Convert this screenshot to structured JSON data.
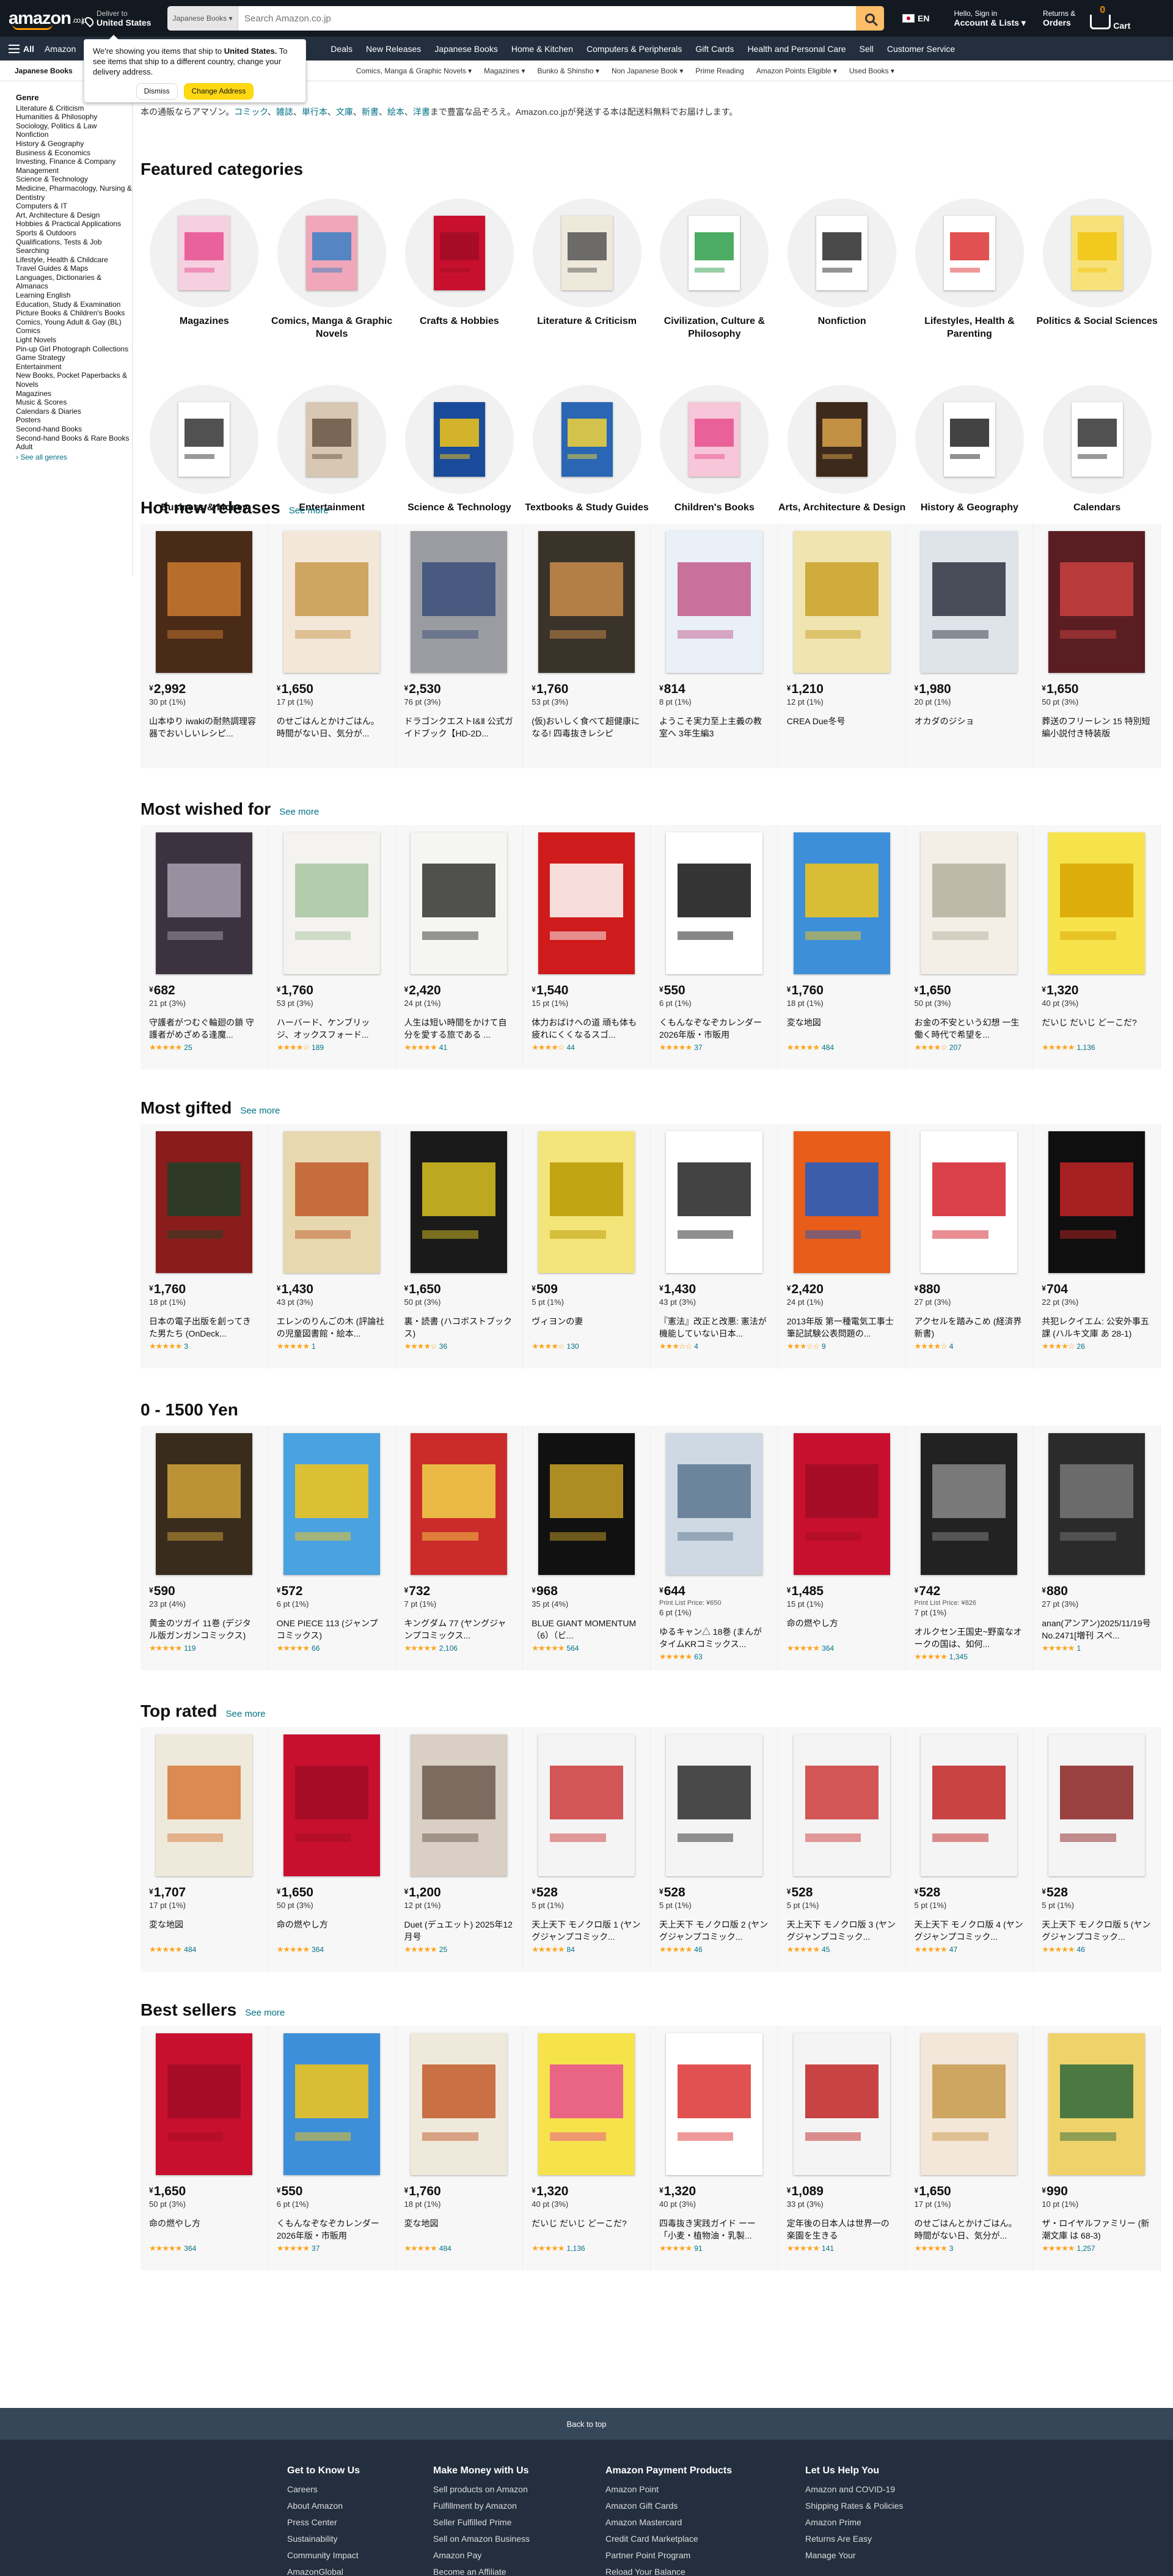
{
  "header": {
    "logo_text": "amazon",
    "logo_suffix": ".co.jp",
    "deliver_line1": "Deliver to",
    "deliver_line2": "United States",
    "search_category": "Japanese Books ▾",
    "search_placeholder": "Search Amazon.co.jp",
    "lang": "EN",
    "account_line1": "Hello, Sign in",
    "account_line2": "Account & Lists ▾",
    "orders_line1": "Returns &",
    "orders_line2": "Orders",
    "cart_count": "0",
    "cart_label": "Cart"
  },
  "nav": {
    "all": "All",
    "items": [
      "Amazon",
      "Deals",
      "New Releases",
      "Japanese Books",
      "Home & Kitchen",
      "Computers & Peripherals",
      "Gift Cards",
      "Health and Personal Care",
      "Sell",
      "Customer Service"
    ]
  },
  "popup": {
    "text_before": "We're showing you items that ship to ",
    "country": "United States.",
    "text_after": " To see items that ship to a different country, change your delivery address.",
    "dismiss": "Dismiss",
    "change": "Change Address"
  },
  "subnav": {
    "title": "Japanese Books",
    "items": [
      "Comics, Manga & Graphic Novels ▾",
      "Magazines ▾",
      "Bunko & Shinsho ▾",
      "Non Japanese Book ▾",
      "Prime Reading",
      "Amazon Points Eligible ▾",
      "Used Books ▾"
    ]
  },
  "sidebar": {
    "heading": "Genre",
    "items": [
      "Literature & Criticism",
      "Humanities & Philosophy",
      "Sociology, Politics & Law",
      "Nonfiction",
      "History & Geography",
      "Business & Economics",
      "Investing, Finance & Company Management",
      "Science & Technology",
      "Medicine, Pharmacology, Nursing & Dentistry",
      "Computers & IT",
      "Art, Architecture & Design",
      "Hobbies & Practical Applications",
      "Sports & Outdoors",
      "Qualifications, Tests & Job Searching",
      "Lifestyle, Health & Childcare",
      "Travel Guides & Maps",
      "Languages, Dictionaries & Almanacs",
      "Learning English",
      "Education, Study & Examination",
      "Picture Books & Children's Books",
      "Comics, Young Adult & Gay (BL) Comics",
      "Light Novels",
      "Pin-up Girl Photograph Collections",
      "Game Strategy",
      "Entertainment",
      "New Books, Pocket Paperbacks & Novels",
      "Magazines",
      "Music & Scores",
      "Calendars & Diaries",
      "Posters",
      "Second-hand Books",
      "Second-hand Books & Rare Books",
      "Adult"
    ],
    "see_all": "› See all genres"
  },
  "main": {
    "page_title": "Japanese Books",
    "intro_prefix": "本の通販ならアマゾン。",
    "intro_links": [
      "コミック",
      "雑誌",
      "単行本",
      "文庫",
      "新書",
      "絵本",
      "洋書"
    ],
    "intro_suffix": "まで豊富な品ぞろえ。Amazon.co.jpが発送する本は配送料無料でお届けします。",
    "featured_title": "Featured categories",
    "categories": [
      "Magazines",
      "Comics, Manga & Graphic Novels",
      "Crafts & Hobbies",
      "Literature & Criticism",
      "Civilization, Culture & Philosophy",
      "Nonfiction",
      "Lifestyles, Health & Parenting",
      "Politics & Social Sciences",
      "Business & Money",
      "Entertainment",
      "Science & Technology",
      "Textbooks & Study Guides",
      "Children's Books",
      "Arts, Architecture & Design",
      "History & Geography",
      "Calendars"
    ]
  },
  "sections": [
    {
      "title": "Hot new releases",
      "see_more": "See more",
      "items": [
        {
          "price": "2,992",
          "pts": "30 pt (1%)",
          "title": "山本ゆり iwakiの耐熱調理容器でおいしいレシピ...",
          "rating": "",
          "reviews": ""
        },
        {
          "price": "1,650",
          "pts": "17 pt (1%)",
          "title": "のせごはんとかけごはん。時間がない日、気分が...",
          "rating": "",
          "reviews": ""
        },
        {
          "price": "2,530",
          "pts": "76 pt (3%)",
          "title": "ドラゴンクエストⅠ&Ⅱ 公式ガイドブック【HD-2D...",
          "rating": "",
          "reviews": ""
        },
        {
          "price": "1,760",
          "pts": "53 pt (3%)",
          "title": "(仮)おいしく食べて超健康になる! 四毒抜きレシピ",
          "rating": "",
          "reviews": ""
        },
        {
          "price": "814",
          "pts": "8 pt (1%)",
          "title": "ようこそ実力至上主義の教室へ 3年生編3",
          "rating": "",
          "reviews": ""
        },
        {
          "price": "1,210",
          "pts": "12 pt (1%)",
          "title": "CREA Due冬号",
          "rating": "",
          "reviews": ""
        },
        {
          "price": "1,980",
          "pts": "20 pt (1%)",
          "title": "オカダのジショ",
          "rating": "",
          "reviews": ""
        },
        {
          "price": "1,650",
          "pts": "50 pt (3%)",
          "title": "葬送のフリーレン 15 特別短編小説付き特装版",
          "rating": "",
          "reviews": ""
        }
      ]
    },
    {
      "title": "Most wished for",
      "see_more": "See more",
      "items": [
        {
          "price": "682",
          "pts": "21 pt (3%)",
          "title": "守護者がつむぐ輪廻の鎖 守護者がめざめる逢魔...",
          "rating": "★★★★★",
          "reviews": "25"
        },
        {
          "price": "1,760",
          "pts": "53 pt (3%)",
          "title": "ハーバード、ケンブリッジ、オックスフォード...",
          "rating": "★★★★☆",
          "reviews": "189"
        },
        {
          "price": "2,420",
          "pts": "24 pt (1%)",
          "title": "人生は短い時間をかけて自分を愛する旅である ...",
          "rating": "★★★★★",
          "reviews": "41"
        },
        {
          "price": "1,540",
          "pts": "15 pt (1%)",
          "title": "体力おばけへの道 頑も体も疲れにくくなるスゴ...",
          "rating": "★★★★☆",
          "reviews": "44"
        },
        {
          "price": "550",
          "pts": "6 pt (1%)",
          "title": "くもんなぞなぞカレンダー2026年版・市販用",
          "rating": "★★★★★",
          "reviews": "37"
        },
        {
          "price": "1,760",
          "pts": "18 pt (1%)",
          "title": "変な地図",
          "rating": "★★★★★",
          "reviews": "484"
        },
        {
          "price": "1,650",
          "pts": "50 pt (3%)",
          "title": "お金の不安という幻想 一生働く時代で希望を...",
          "rating": "★★★★☆",
          "reviews": "207"
        },
        {
          "price": "1,320",
          "pts": "40 pt (3%)",
          "title": "だいじ だいじ どーこだ?",
          "rating": "★★★★★",
          "reviews": "1,136"
        }
      ]
    },
    {
      "title": "Most gifted",
      "see_more": "See more",
      "items": [
        {
          "price": "1,760",
          "pts": "18 pt (1%)",
          "title": "日本の電子出版を創ってきた男たち (OnDeck...",
          "rating": "★★★★★",
          "reviews": "3"
        },
        {
          "price": "1,430",
          "pts": "43 pt (3%)",
          "title": "エレンのりんごの木 (評論社の児童図書館・絵本...",
          "rating": "★★★★★",
          "reviews": "1"
        },
        {
          "price": "1,650",
          "pts": "50 pt (3%)",
          "title": "裏・読書 (ハコボストブックス)",
          "rating": "★★★★☆",
          "reviews": "36"
        },
        {
          "price": "509",
          "pts": "5 pt (1%)",
          "title": "ヴィヨンの妻",
          "rating": "★★★★☆",
          "reviews": "130"
        },
        {
          "price": "1,430",
          "pts": "43 pt (3%)",
          "title": "『憲法』改正と改悪: 憲法が機能していない日本...",
          "rating": "★★★☆☆",
          "reviews": "4"
        },
        {
          "price": "2,420",
          "pts": "24 pt (1%)",
          "title": "2013年版 第一種電気工事士筆記試験公表問題の...",
          "rating": "★★★☆☆",
          "reviews": "9"
        },
        {
          "price": "880",
          "pts": "27 pt (3%)",
          "title": "アクセルを踏みこめ (経済界新書)",
          "rating": "★★★★☆",
          "reviews": "4"
        },
        {
          "price": "704",
          "pts": "22 pt (3%)",
          "title": "共犯レクイエム: 公安外事五課 (ハルキ文庫 あ 28-1)",
          "rating": "★★★★☆",
          "reviews": "26"
        }
      ]
    },
    {
      "title": "0 - 1500 Yen",
      "see_more": "",
      "items": [
        {
          "price": "590",
          "pts": "23 pt (4%)",
          "title": "黄金のツガイ 11巻 (デジタル版ガンガンコミックス)",
          "rating": "★★★★★",
          "reviews": "119"
        },
        {
          "price": "572",
          "pts": "6 pt (1%)",
          "title": "ONE PIECE 113 (ジャンプコミックス)",
          "rating": "★★★★★",
          "reviews": "66"
        },
        {
          "price": "732",
          "pts": "7 pt (1%)",
          "title": "キングダム 77 (ヤングジャンプコミックス...",
          "rating": "★★★★★",
          "reviews": "2,106"
        },
        {
          "price": "968",
          "pts": "35 pt (4%)",
          "title": "BLUE GIANT MOMENTUM（6）（ビ...",
          "rating": "★★★★★",
          "reviews": "564"
        },
        {
          "price": "644",
          "list": "Print List Price: ¥650",
          "pts": "6 pt (1%)",
          "title": "ゆるキャン△ 18巻 (まんがタイムKRコミックス...",
          "rating": "★★★★★",
          "reviews": "63"
        },
        {
          "price": "1,485",
          "pts": "15 pt (1%)",
          "title": "命の燃やし方",
          "rating": "★★★★★",
          "reviews": "364"
        },
        {
          "price": "742",
          "list": "Print List Price: ¥826",
          "pts": "7 pt (1%)",
          "title": "オルクセン王国史~野蛮なオークの国は、如何...",
          "rating": "★★★★★",
          "reviews": "1,345"
        },
        {
          "price": "880",
          "pts": "27 pt (3%)",
          "title": "anan(アンアン)2025/11/19号 No.2471[増刊 スペ...",
          "rating": "★★★★★",
          "reviews": "1"
        }
      ]
    },
    {
      "title": "Top rated",
      "see_more": "See more",
      "items": [
        {
          "price": "1,707",
          "pts": "17 pt (1%)",
          "title": "変な地図",
          "rating": "★★★★★",
          "reviews": "484"
        },
        {
          "price": "1,650",
          "pts": "50 pt (3%)",
          "title": "命の燃やし方",
          "rating": "★★★★★",
          "reviews": "364"
        },
        {
          "price": "1,200",
          "pts": "12 pt (1%)",
          "title": "Duet (デュエット) 2025年12月号",
          "rating": "★★★★★",
          "reviews": "25"
        },
        {
          "price": "528",
          "pts": "5 pt (1%)",
          "title": "天上天下 モノクロ版 1 (ヤングジャンプコミック...",
          "rating": "★★★★★",
          "reviews": "84"
        },
        {
          "price": "528",
          "pts": "5 pt (1%)",
          "title": "天上天下 モノクロ版 2 (ヤングジャンプコミック...",
          "rating": "★★★★★",
          "reviews": "46"
        },
        {
          "price": "528",
          "pts": "5 pt (1%)",
          "title": "天上天下 モノクロ版 3 (ヤングジャンプコミック...",
          "rating": "★★★★★",
          "reviews": "45"
        },
        {
          "price": "528",
          "pts": "5 pt (1%)",
          "title": "天上天下 モノクロ版 4 (ヤングジャンプコミック...",
          "rating": "★★★★★",
          "reviews": "47"
        },
        {
          "price": "528",
          "pts": "5 pt (1%)",
          "title": "天上天下 モノクロ版 5 (ヤングジャンプコミック...",
          "rating": "★★★★★",
          "reviews": "46"
        }
      ]
    },
    {
      "title": "Best sellers",
      "see_more": "See more",
      "items": [
        {
          "price": "1,650",
          "pts": "50 pt (3%)",
          "title": "命の燃やし方",
          "rating": "★★★★★",
          "reviews": "364"
        },
        {
          "price": "550",
          "pts": "6 pt (1%)",
          "title": "くもんなぞなぞカレンダー2026年版・市販用",
          "rating": "★★★★★",
          "reviews": "37"
        },
        {
          "price": "1,760",
          "pts": "18 pt (1%)",
          "title": "変な地図",
          "rating": "★★★★★",
          "reviews": "484"
        },
        {
          "price": "1,320",
          "pts": "40 pt (3%)",
          "title": "だいじ だいじ どーこだ?",
          "rating": "★★★★★",
          "reviews": "1,136"
        },
        {
          "price": "1,320",
          "pts": "40 pt (3%)",
          "title": "四毒抜き実践ガイド ーー「小麦・植物油・乳製...",
          "rating": "★★★★★",
          "reviews": "91"
        },
        {
          "price": "1,089",
          "pts": "33 pt (3%)",
          "title": "定年後の日本人は世界一の楽園を生きる",
          "rating": "★★★★★",
          "reviews": "141"
        },
        {
          "price": "1,650",
          "pts": "17 pt (1%)",
          "title": "のせごはんとかけごはん。時間がない日、気分が...",
          "rating": "★★★★★",
          "reviews": "3"
        },
        {
          "price": "990",
          "pts": "10 pt (1%)",
          "title": "ザ・ロイヤルファミリー (新潮文庫 は 68-3)",
          "rating": "★★★★★",
          "reviews": "1,257"
        }
      ]
    }
  ],
  "footer": {
    "back_to_top": "Back to top",
    "columns": [
      {
        "title": "Get to Know Us",
        "links": [
          "Careers",
          "About Amazon",
          "Press Center",
          "Sustainability",
          "Community Impact",
          "AmazonGlobal"
        ]
      },
      {
        "title": "Make Money with Us",
        "links": [
          "Sell products on Amazon",
          "Fulfillment by Amazon",
          "Seller Fulfilled Prime",
          "Sell on Amazon Business",
          "Amazon Pay",
          "Become an Affiliate"
        ]
      },
      {
        "title": "Amazon Payment Products",
        "links": [
          "Amazon Point",
          "Amazon Gift Cards",
          "Amazon Mastercard",
          "Credit Card Marketplace",
          "Partner Point Program",
          "Reload Your Balance"
        ]
      },
      {
        "title": "Let Us Help You",
        "links": [
          "Amazon and COVID-19",
          "Shipping Rates & Policies",
          "Amazon Prime",
          "Returns Are Easy",
          "Manage Your"
        ]
      }
    ]
  },
  "colors": {
    "topbar": "#131921",
    "nav": "#232f3e",
    "accent": "#febd69",
    "link": "#007185",
    "star": "#ffa41c"
  }
}
